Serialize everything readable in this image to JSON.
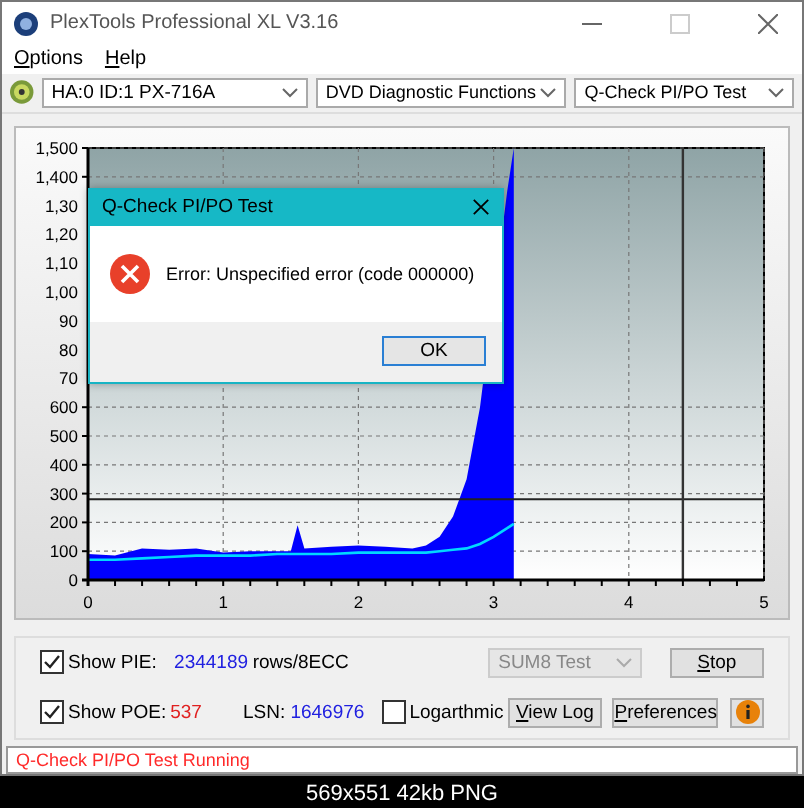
{
  "window": {
    "title": "PlexTools Professional XL V3.16"
  },
  "menu": [
    {
      "label": "Options"
    },
    {
      "label": "Help"
    }
  ],
  "toolbar": {
    "drive": "HA:0 ID:1  PX-716A",
    "function": "DVD Diagnostic Functions",
    "test": "Q-Check PI/PO Test"
  },
  "chart": {
    "chart_data": {
      "type": "area",
      "x": [
        0,
        0.2,
        0.4,
        0.6,
        0.8,
        1.0,
        1.2,
        1.4,
        1.5,
        1.55,
        1.6,
        1.8,
        2.0,
        2.2,
        2.4,
        2.5,
        2.6,
        2.7,
        2.8,
        2.9,
        3.0,
        3.1,
        3.15
      ],
      "series": [
        {
          "type": "area",
          "color": "#0000ff",
          "values": [
            90,
            85,
            110,
            105,
            110,
            95,
            100,
            100,
            100,
            190,
            110,
            115,
            120,
            115,
            110,
            120,
            150,
            220,
            350,
            600,
            null,
            1350,
            1500
          ]
        },
        {
          "type": "line",
          "color": "#00d8ff",
          "values": [
            70,
            70,
            75,
            80,
            85,
            85,
            85,
            90,
            90,
            90,
            90,
            90,
            95,
            95,
            95,
            95,
            100,
            105,
            110,
            125,
            150,
            180,
            195
          ]
        }
      ],
      "xlim": [
        0,
        5
      ],
      "ylim": [
        0,
        1500
      ],
      "xticks": [
        0,
        1,
        2,
        3,
        4,
        5
      ],
      "yticks": [
        0,
        100,
        200,
        300,
        400,
        500,
        600,
        {
          "value": 1400,
          "label": "1,400"
        },
        {
          "value": 1500,
          "label": "1,500"
        }
      ],
      "ref_lines": [
        {
          "axis": "y",
          "value": 280
        },
        {
          "axis": "x",
          "value": 4.4
        }
      ],
      "grid": true
    },
    "clipped_tick_labels": [
      "1,30",
      "1,20",
      "1,10",
      "1,00",
      "90",
      "80",
      "70"
    ]
  },
  "dialog": {
    "title": "Q-Check PI/PO Test",
    "message": "Error: Unspecified error (code 000000)",
    "button": "OK"
  },
  "controls": {
    "show_pie": {
      "label": "Show PIE:",
      "checked": true,
      "value": "2344189",
      "unit": "rows/8ECC"
    },
    "show_poe": {
      "label": "Show POE:",
      "checked": true,
      "value": "537"
    },
    "lsn": {
      "label": "LSN:",
      "value": "1646976"
    },
    "logarithmic": {
      "label": "Logarthmic",
      "checked": false
    },
    "mode": {
      "value": "SUM8 Test",
      "disabled": true
    },
    "buttons": [
      {
        "label": "Stop"
      },
      {
        "label": "View Log"
      },
      {
        "label": "Preferences"
      }
    ]
  },
  "status_bar": "Q-Check PI/PO Test Running",
  "caption": "569x551 42kb PNG"
}
